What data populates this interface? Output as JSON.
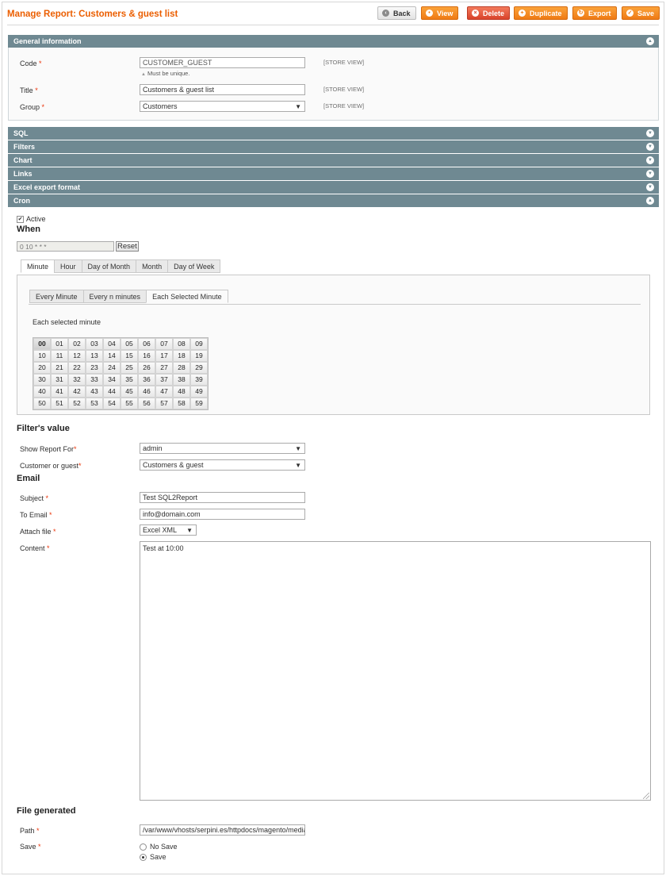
{
  "page": {
    "title": "Manage Report: Customers & guest list"
  },
  "toolbar": {
    "back": "Back",
    "view": "View",
    "delete": "Delete",
    "duplicate": "Duplicate",
    "export": "Export",
    "save": "Save"
  },
  "sections": {
    "general": "General information",
    "sql": "SQL",
    "filters": "Filters",
    "chart": "Chart",
    "links": "Links",
    "excel": "Excel export format",
    "cron": "Cron"
  },
  "general": {
    "code_label": "Code",
    "code_value": "CUSTOMER_GUEST",
    "code_note": "Must be unique.",
    "title_label": "Title",
    "title_value": "Customers & guest list",
    "group_label": "Group",
    "group_value": "Customers",
    "scope": "[STORE VIEW]"
  },
  "cron": {
    "active_label": "Active",
    "when_heading": "When",
    "expression": "0 10 * * *",
    "reset": "Reset",
    "tabs": [
      "Minute",
      "Hour",
      "Day of Month",
      "Month",
      "Day of Week"
    ],
    "subtabs": [
      "Every Minute",
      "Every n minutes",
      "Each Selected Minute"
    ],
    "each_label": "Each selected minute",
    "minutes": [
      "00",
      "01",
      "02",
      "03",
      "04",
      "05",
      "06",
      "07",
      "08",
      "09",
      "10",
      "11",
      "12",
      "13",
      "14",
      "15",
      "16",
      "17",
      "18",
      "19",
      "20",
      "21",
      "22",
      "23",
      "24",
      "25",
      "26",
      "27",
      "28",
      "29",
      "30",
      "31",
      "32",
      "33",
      "34",
      "35",
      "36",
      "37",
      "38",
      "39",
      "40",
      "41",
      "42",
      "43",
      "44",
      "45",
      "46",
      "47",
      "48",
      "49",
      "50",
      "51",
      "52",
      "53",
      "54",
      "55",
      "56",
      "57",
      "58",
      "59"
    ],
    "selected_minute": "00"
  },
  "filters_value": {
    "heading": "Filter's value",
    "show_for_label": "Show Report For",
    "show_for_value": "admin",
    "customer_label": "Customer or guest",
    "customer_value": "Customers & guest"
  },
  "email": {
    "heading": "Email",
    "subject_label": "Subject",
    "subject_value": "Test SQL2Report",
    "to_label": "To Email",
    "to_value": "info@domain.com",
    "attach_label": "Attach file",
    "attach_value": "Excel XML",
    "content_label": "Content",
    "content_value": "Test at 10:00"
  },
  "file": {
    "heading": "File generated",
    "path_label": "Path",
    "path_value": "/var/www/vhosts/serpini.es/httpdocs/magento/media",
    "save_label": "Save",
    "option_no_save": "No Save",
    "option_save": "Save"
  },
  "colors": {
    "accent": "#eb5e00",
    "section_bar": "#6f8992",
    "required": "#eb340a"
  }
}
